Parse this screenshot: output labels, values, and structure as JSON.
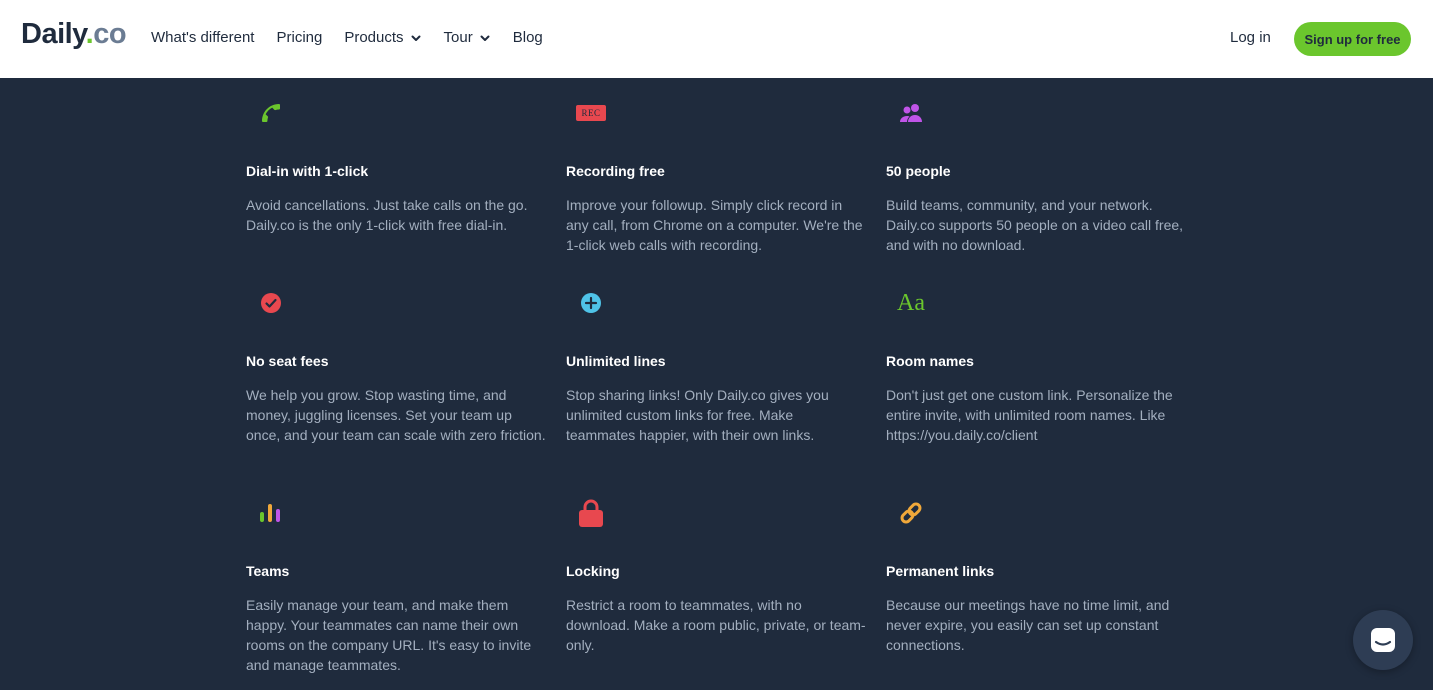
{
  "nav": {
    "logo_name": "Daily",
    "logo_dot": ".",
    "logo_tld": "co",
    "links": [
      {
        "label": "What's different"
      },
      {
        "label": "Pricing"
      },
      {
        "label": "Products"
      },
      {
        "label": "Tour"
      },
      {
        "label": "Blog"
      }
    ],
    "login": "Log in",
    "signup": "Sign up for free"
  },
  "colors": {
    "background": "#1f2b3d",
    "accent_green": "#6bc62d",
    "red": "#e8484f",
    "cyan": "#4fc3e8",
    "purple": "#c054e8",
    "orange": "#f0a83a"
  },
  "features": [
    {
      "icon": "phone-icon",
      "title": "Dial-in with 1-click",
      "desc": "Avoid cancellations. Just take calls on the go. Daily.co is the only 1-click with free dial-in."
    },
    {
      "icon": "rec-badge-icon",
      "icon_text": "REC",
      "title": "Recording free",
      "desc": "Improve your followup. Simply click record in any call, from Chrome on a computer. We're the 1-click web calls with recording."
    },
    {
      "icon": "people-icon",
      "title": "50 people",
      "desc": "Build teams, community, and your network. Daily.co supports 50 people on a video call free, and with no download."
    },
    {
      "icon": "check-circle-icon",
      "title": "No seat fees",
      "desc": "We help you grow. Stop wasting time, and money, juggling licenses. Set your team up once, and your team can scale with zero friction."
    },
    {
      "icon": "plus-circle-icon",
      "title": "Unlimited lines",
      "desc": "Stop sharing links! Only Daily.co gives you unlimited custom links for free. Make teammates happier, with their own links."
    },
    {
      "icon": "font-aa-icon",
      "icon_text": "Aa",
      "title": "Room names",
      "desc": "Don't just get one custom link. Personalize the entire invite, with unlimited room names. Like https://you.daily.co/client"
    },
    {
      "icon": "bars-icon",
      "title": "Teams",
      "desc": "Easily manage your team, and make them happy. Your teammates can name their own rooms on the company URL. It's easy to invite and manage teammates."
    },
    {
      "icon": "lock-icon",
      "title": "Locking",
      "desc": "Restrict a room to teammates, with no download. Make a room public, private, or team-only."
    },
    {
      "icon": "link-icon",
      "title": "Permanent links",
      "desc": "Because our meetings have no time limit, and never expire, you easily can set up constant connections."
    }
  ]
}
